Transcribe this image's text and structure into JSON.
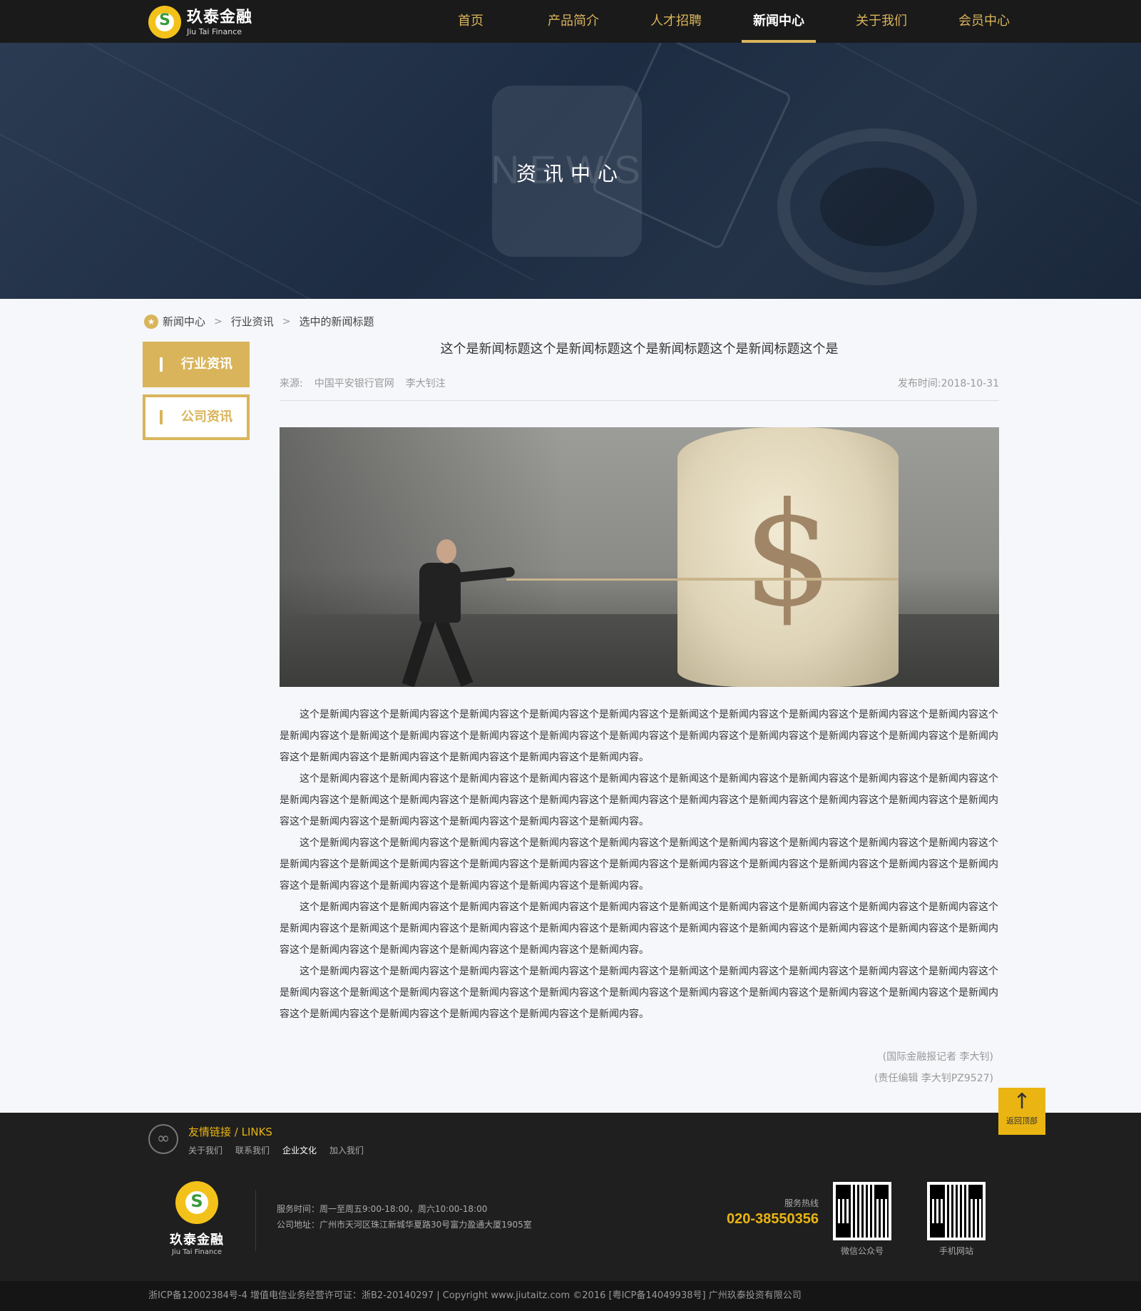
{
  "header": {
    "logo_cn": "玖泰金融",
    "logo_en": "Jiu Tai Finance",
    "nav": [
      {
        "label": "首页"
      },
      {
        "label": "产品简介"
      },
      {
        "label": "人才招聘"
      },
      {
        "label": "新闻中心",
        "active": true
      },
      {
        "label": "关于我们"
      },
      {
        "label": "会员中心"
      }
    ]
  },
  "banner": {
    "bg_text": "NEWS",
    "title": "资讯中心"
  },
  "breadcrumb": [
    "新闻中心",
    "行业资讯",
    "选中的新闻标题"
  ],
  "sidebar": [
    {
      "label": "行业资讯",
      "active": true
    },
    {
      "label": "公司资讯",
      "active": false
    }
  ],
  "article": {
    "title": "这个是新闻标题这个是新闻标题这个是新闻标题这个是新闻标题这个是",
    "source_label": "来源:",
    "source": "中国平安银行官网",
    "author": "李大钊注",
    "date_label": "发布时间:",
    "date": "2018-10-31",
    "image_symbol": "$",
    "paragraphs": [
      "这个是新闻内容这个是新闻内容这个是新闻内容这个是新闻内容这个是新闻内容这个是新闻这个是新闻内容这个是新闻内容这个是新闻内容这个是新闻内容这个是新闻内容这个是新闻这个是新闻内容这个是新闻内容这个是新闻内容这个是新闻内容这个是新闻内容这个是新闻内容这个是新闻内容这个是新闻内容这个是新闻内容这个是新闻内容这个是新闻内容这个是新闻内容这个是新闻内容这个是新闻内容。",
      "这个是新闻内容这个是新闻内容这个是新闻内容这个是新闻内容这个是新闻内容这个是新闻这个是新闻内容这个是新闻内容这个是新闻内容这个是新闻内容这个是新闻内容这个是新闻这个是新闻内容这个是新闻内容这个是新闻内容这个是新闻内容这个是新闻内容这个是新闻内容这个是新闻内容这个是新闻内容这个是新闻内容这个是新闻内容这个是新闻内容这个是新闻内容这个是新闻内容这个是新闻内容。",
      "这个是新闻内容这个是新闻内容这个是新闻内容这个是新闻内容这个是新闻内容这个是新闻这个是新闻内容这个是新闻内容这个是新闻内容这个是新闻内容这个是新闻内容这个是新闻这个是新闻内容这个是新闻内容这个是新闻内容这个是新闻内容这个是新闻内容这个是新闻内容这个是新闻内容这个是新闻内容这个是新闻内容这个是新闻内容这个是新闻内容这个是新闻内容这个是新闻内容这个是新闻内容。",
      "这个是新闻内容这个是新闻内容这个是新闻内容这个是新闻内容这个是新闻内容这个是新闻这个是新闻内容这个是新闻内容这个是新闻内容这个是新闻内容这个是新闻内容这个是新闻这个是新闻内容这个是新闻内容这个是新闻内容这个是新闻内容这个是新闻内容这个是新闻内容这个是新闻内容这个是新闻内容这个是新闻内容这个是新闻内容这个是新闻内容这个是新闻内容这个是新闻内容这个是新闻内容。",
      "这个是新闻内容这个是新闻内容这个是新闻内容这个是新闻内容这个是新闻内容这个是新闻这个是新闻内容这个是新闻内容这个是新闻内容这个是新闻内容这个是新闻内容这个是新闻这个是新闻内容这个是新闻内容这个是新闻内容这个是新闻内容这个是新闻内容这个是新闻内容这个是新闻内容这个是新闻内容这个是新闻内容这个是新闻内容这个是新闻内容这个是新闻内容这个是新闻内容这个是新闻内容。"
    ],
    "credit_reporter": "(国际金融报记者  李大钊)",
    "credit_editor": "(责任编辑  李大钊PZ9527)"
  },
  "back_to_top": {
    "label": "返回顶部"
  },
  "footer": {
    "links_title": "友情链接 / LINKS",
    "links": [
      {
        "label": "关于我们"
      },
      {
        "label": "联系我们"
      },
      {
        "label": "企业文化",
        "highlight": true
      },
      {
        "label": "加入我们"
      }
    ],
    "logo_cn": "玖泰金融",
    "logo_en": "Jiu Tai Finance",
    "service_hours": "服务时间：周一至周五9:00-18:00，周六10:00-18:00",
    "address": "公司地址：广州市天河区珠江新城华夏路30号富力盈通大厦1905室",
    "hotline_label": "服务热线",
    "hotline": "020-38550356",
    "qr_codes": [
      {
        "label": "微信公众号"
      },
      {
        "label": "手机网站"
      }
    ],
    "copyright": "浙ICP备12002384号-4  增值电信业务经营许可证：浙B2-20140297   |   Copyright www.jiutaitz.com ©2016 [粤ICP备14049938号] 广州玖泰投资有限公司"
  },
  "colors": {
    "gold": "#d9b45a",
    "accent_yellow": "#eab512",
    "header_bg": "#1a1a1a",
    "footer_bg": "#1f1f1f"
  }
}
